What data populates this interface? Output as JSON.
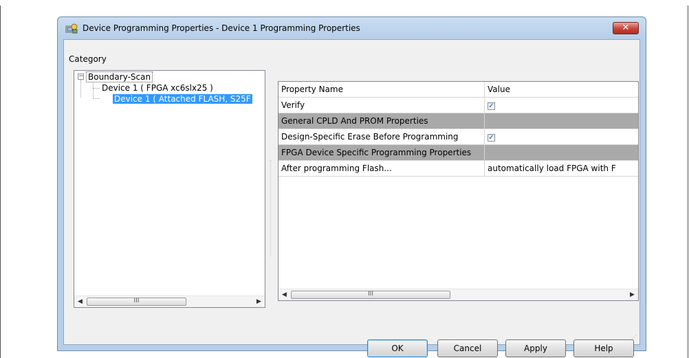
{
  "window": {
    "title": "Device Programming Properties - Device 1 Programming Properties",
    "close_label": "✕"
  },
  "category": {
    "label": "Category",
    "tree": {
      "root": "Boundary-Scan",
      "expander": "−",
      "children": [
        "Device 1 ( FPGA xc6slx25 )",
        "Device 1 ( Attached FLASH, S25F"
      ]
    },
    "scroll_left": "◀",
    "scroll_right": "▶",
    "scroll_grip": "III"
  },
  "properties": {
    "headers": [
      "Property Name",
      "Value"
    ],
    "rows": [
      {
        "name": "Verify",
        "value": "",
        "checked": true
      },
      {
        "name": "General CPLD And PROM Properties",
        "group": true
      },
      {
        "name": "Design-Specific Erase Before Programming",
        "value": "",
        "checked": true
      },
      {
        "name": "FPGA Device Specific Programming Properties",
        "group": true
      },
      {
        "name": "After programming Flash...",
        "value": "automatically load FPGA with F"
      }
    ],
    "check_mark": "✓",
    "scroll_left": "◀",
    "scroll_right": "▶",
    "scroll_grip": "III"
  },
  "buttons": {
    "ok": "OK",
    "cancel": "Cancel",
    "apply": "Apply",
    "help": "Help"
  },
  "colors": {
    "selection": "#3399ff",
    "group_row": "#a9a9a9",
    "close_button": "#c8433a"
  }
}
